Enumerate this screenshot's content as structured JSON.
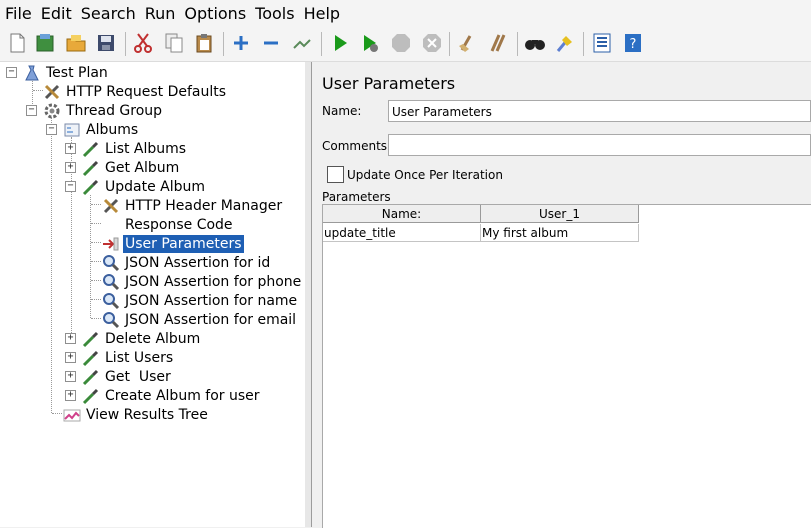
{
  "menu": [
    "File",
    "Edit",
    "Search",
    "Run",
    "Options",
    "Tools",
    "Help"
  ],
  "toolbar": {
    "buttons": [
      "new-icon",
      "templates-icon",
      "open-icon",
      "save-icon",
      "cut-icon",
      "copy-icon",
      "paste-icon",
      "expand-all-icon",
      "collapse-all-icon",
      "toggle-icon",
      "start-icon",
      "start-no-pauses-icon",
      "stop-icon",
      "shutdown-icon",
      "clear-icon",
      "clear-all-icon",
      "search-icon",
      "reset-search-icon",
      "function-helper-icon",
      "help-icon"
    ]
  },
  "tree": {
    "nodes": [
      {
        "label": "Test Plan",
        "icon": "test-plan-icon"
      },
      {
        "label": "HTTP Request Defaults",
        "icon": "config-wrench-icon"
      },
      {
        "label": "Thread Group",
        "icon": "thread-group-gear-icon"
      },
      {
        "label": "Albums",
        "icon": "controller-icon"
      },
      {
        "label": "List Albums",
        "icon": "sampler-pipette-icon"
      },
      {
        "label": "Get Album",
        "icon": "sampler-pipette-icon"
      },
      {
        "label": "Update Album",
        "icon": "sampler-pipette-icon"
      },
      {
        "label": "HTTP Header Manager",
        "icon": "config-wrench-icon"
      },
      {
        "label": "Response Code",
        "icon": "blank-icon"
      },
      {
        "label": "User Parameters",
        "icon": "pre-processor-icon"
      },
      {
        "label": "JSON Assertion for id",
        "icon": "assertion-magnifier-icon"
      },
      {
        "label": "JSON Assertion for phone",
        "icon": "assertion-magnifier-icon"
      },
      {
        "label": "JSON Assertion for name",
        "icon": "assertion-magnifier-icon"
      },
      {
        "label": "JSON Assertion for email",
        "icon": "assertion-magnifier-icon"
      },
      {
        "label": "Delete Album",
        "icon": "sampler-pipette-icon"
      },
      {
        "label": "List Users",
        "icon": "sampler-pipette-icon"
      },
      {
        "label": "Get  User",
        "icon": "sampler-pipette-icon"
      },
      {
        "label": "Create Album for user",
        "icon": "sampler-pipette-icon"
      },
      {
        "label": "View Results Tree",
        "icon": "listener-graph-icon"
      }
    ]
  },
  "panel": {
    "title": "User Parameters",
    "name_label": "Name:",
    "name_value": "User Parameters",
    "comments_label": "Comments:",
    "comments_value": "",
    "checkbox_label": "Update Once Per Iteration",
    "checkbox_checked": false,
    "parameters_label": "Parameters",
    "table": {
      "headers": [
        "Name:",
        "User_1"
      ],
      "rows": [
        [
          "update_title",
          "My first album"
        ]
      ]
    }
  },
  "colors": {
    "selection": "#1e5fb4",
    "start_green": "#1a9a1a"
  }
}
